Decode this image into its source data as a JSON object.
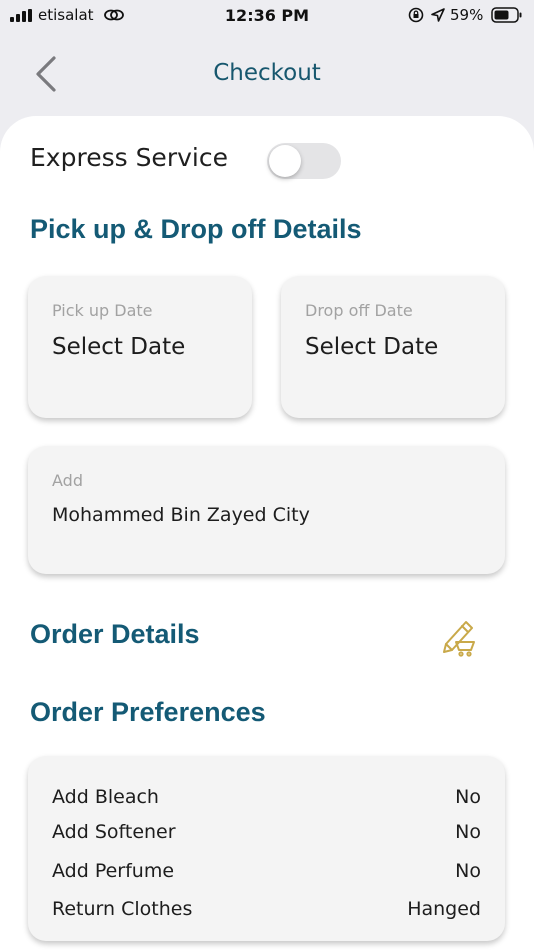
{
  "status_bar": {
    "carrier": "etisalat",
    "time": "12:36 PM",
    "battery": "59%"
  },
  "nav": {
    "title": "Checkout"
  },
  "express": {
    "label": "Express Service",
    "enabled": false
  },
  "pickup_section": {
    "title": "Pick up & Drop off Details",
    "pickup": {
      "label": "Pick up Date",
      "value": "Select Date"
    },
    "dropoff": {
      "label": "Drop off Date",
      "value": "Select Date"
    },
    "address": {
      "label": "Add",
      "value": "Mohammed Bin Zayed City"
    }
  },
  "order_details": {
    "title": "Order Details",
    "edit_icon": "edit-cart-icon"
  },
  "preferences": {
    "title": "Order Preferences",
    "items": [
      {
        "label": "Add Bleach",
        "value": "No"
      },
      {
        "label": "Add Softener",
        "value": "No"
      },
      {
        "label": "Add Perfume",
        "value": "No"
      },
      {
        "label": "Return Clothes",
        "value": "Hanged"
      }
    ]
  },
  "colors": {
    "accent": "#145a75",
    "icon_gold": "#c9a94a"
  }
}
